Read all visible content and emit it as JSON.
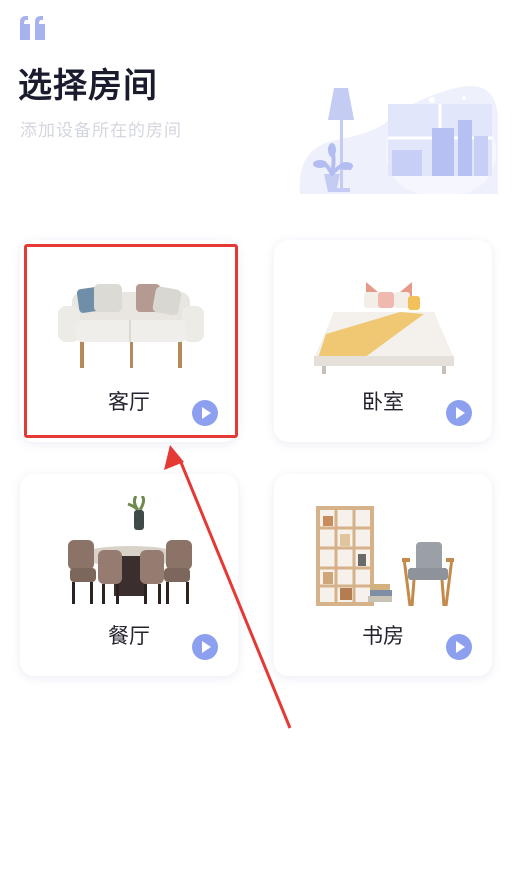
{
  "header": {
    "title": "选择房间",
    "subtitle": "添加设备所在的房间"
  },
  "rooms": [
    {
      "label": "客厅",
      "icon": "sofa-icon"
    },
    {
      "label": "卧室",
      "icon": "bed-icon"
    },
    {
      "label": "餐厅",
      "icon": "dining-table-icon"
    },
    {
      "label": "书房",
      "icon": "bookshelf-icon"
    }
  ],
  "colors": {
    "accent": "#8da0f0",
    "highlight": "#e53935",
    "title": "#1a1c2e",
    "subtitle": "#d4d6e0"
  }
}
